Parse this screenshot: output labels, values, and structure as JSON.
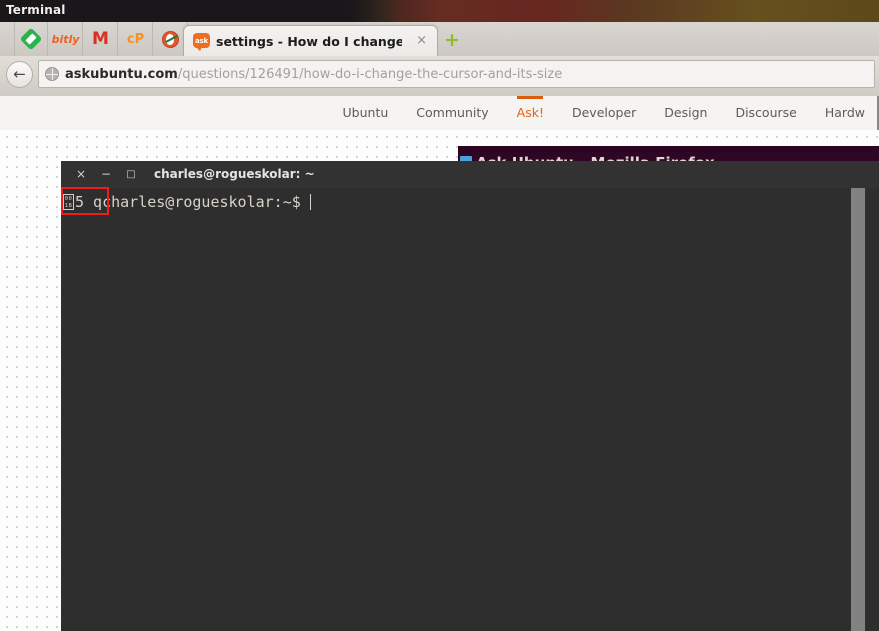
{
  "desktop": {
    "panel_title": "Terminal"
  },
  "browser": {
    "bookmarks": [
      {
        "name": "feedly-bookmark",
        "label": ""
      },
      {
        "name": "bitly-bookmark",
        "label": "bitly"
      },
      {
        "name": "gmail-bookmark",
        "label": "M"
      },
      {
        "name": "cpanel-bookmark",
        "label": "cP"
      },
      {
        "name": "duckduckgo-bookmark",
        "label": ""
      }
    ],
    "tab": {
      "favicon_label": "ask",
      "title": "settings - How do I change th...",
      "close_label": "×"
    },
    "new_tab_label": "+",
    "back_label": "←",
    "url": {
      "host": "askubuntu.com",
      "path": "/questions/126491/how-do-i-change-the-cursor-and-its-size"
    }
  },
  "page": {
    "nav_items": [
      {
        "label": "Ubuntu",
        "current": false
      },
      {
        "label": "Community",
        "current": false
      },
      {
        "label": "Ask!",
        "current": true
      },
      {
        "label": "Developer",
        "current": false
      },
      {
        "label": "Design",
        "current": false
      },
      {
        "label": "Discourse",
        "current": false
      },
      {
        "label": "Hardw",
        "current": false
      }
    ]
  },
  "behind_window": {
    "title": "Ask Ubuntu - Mozilla Firefox"
  },
  "terminal": {
    "titlebar": {
      "close": "×",
      "minimize": "−",
      "maximize": "□",
      "title": "charles@rogueskolar: ~"
    },
    "content": {
      "tofu_hex_top": "00",
      "tofu_hex_bottom": "1B",
      "text_after_tofu": "5 qcharles@rogueskolar:~$ "
    }
  },
  "colors": {
    "terminal_bg": "#2e2e2e",
    "terminal_titlebar": "#323232",
    "ubuntu_purple": "#300a24",
    "accent_orange": "#e8640f",
    "highlight_red": "#ee1c1c",
    "scrollbar_grey": "#828282"
  }
}
